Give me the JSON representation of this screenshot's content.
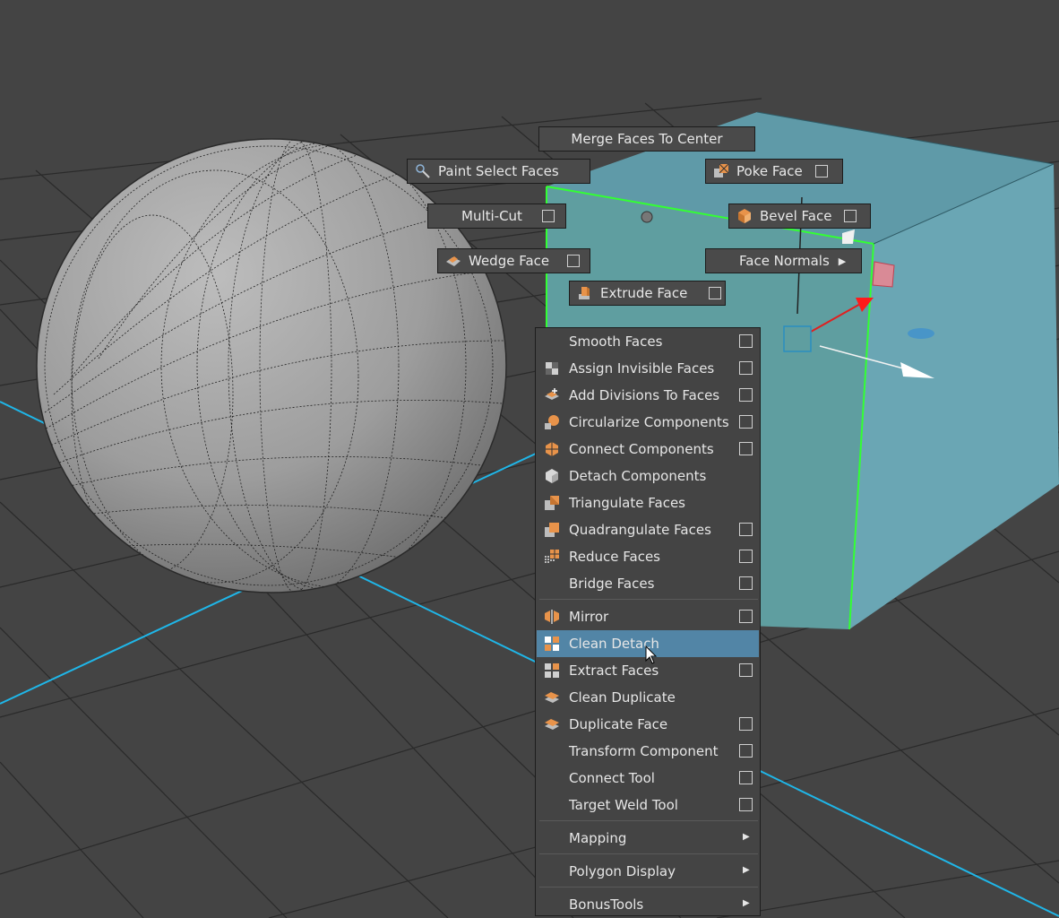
{
  "marking_menu": {
    "merge": "Merge Faces To Center",
    "paint_select": "Paint Select Faces",
    "poke": "Poke Face",
    "multi_cut": "Multi-Cut",
    "bevel": "Bevel Face",
    "wedge": "Wedge Face",
    "face_normals": "Face Normals",
    "extrude": "Extrude Face"
  },
  "menu": {
    "items": [
      {
        "label": "Smooth Faces",
        "icon": "none",
        "option_box": true
      },
      {
        "label": "Assign Invisible Faces",
        "icon": "invisible-faces-icon",
        "option_box": true
      },
      {
        "label": "Add Divisions To Faces",
        "icon": "add-divisions-icon",
        "option_box": true
      },
      {
        "label": "Circularize Components",
        "icon": "circularize-icon",
        "option_box": true
      },
      {
        "label": "Connect Components",
        "icon": "connect-components-icon",
        "option_box": true
      },
      {
        "label": "Detach Components",
        "icon": "detach-components-icon",
        "option_box": false
      },
      {
        "label": "Triangulate Faces",
        "icon": "triangulate-icon",
        "option_box": false
      },
      {
        "label": "Quadrangulate Faces",
        "icon": "quadrangulate-icon",
        "option_box": true
      },
      {
        "label": "Reduce Faces",
        "icon": "reduce-icon",
        "option_box": true
      },
      {
        "label": "Bridge Faces",
        "icon": "none",
        "option_box": true
      },
      {
        "label": "Mirror",
        "icon": "mirror-icon",
        "option_box": true
      },
      {
        "label": "Clean Detach",
        "icon": "clean-detach-icon",
        "option_box": false,
        "highlighted": true
      },
      {
        "label": "Extract Faces",
        "icon": "extract-icon",
        "option_box": true
      },
      {
        "label": "Clean Duplicate",
        "icon": "clean-duplicate-icon",
        "option_box": false
      },
      {
        "label": "Duplicate Face",
        "icon": "duplicate-icon",
        "option_box": true
      },
      {
        "label": "Transform Component",
        "icon": "none",
        "option_box": true
      },
      {
        "label": "Connect Tool",
        "icon": "none",
        "option_box": true
      },
      {
        "label": "Target Weld Tool",
        "icon": "none",
        "option_box": true
      },
      {
        "label": "Mapping",
        "submenu": true
      },
      {
        "label": "Polygon Display",
        "submenu": true
      },
      {
        "label": "BonusTools",
        "submenu": true
      }
    ]
  },
  "colors": {
    "viewport_bg": "#444444",
    "grid_line": "#2b2b2b",
    "grid_axis": "#1fb6e8",
    "cube_face": "#6aa6b4",
    "selection_edge": "#33ff33",
    "menu_highlight": "#5285a6",
    "icon_orange": "#e8934a"
  }
}
